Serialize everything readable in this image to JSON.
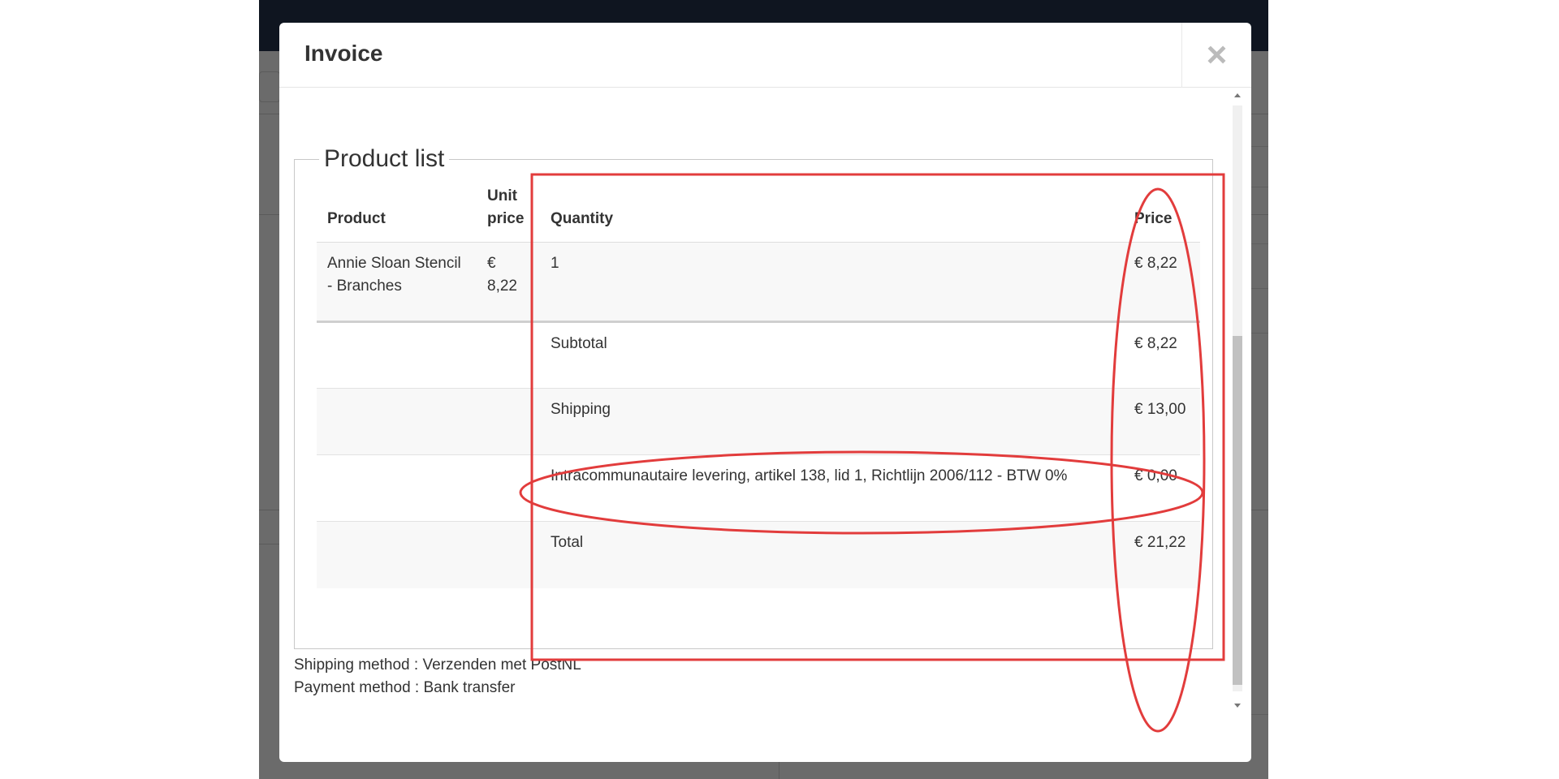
{
  "modal": {
    "title": "Invoice",
    "close_label": "×"
  },
  "fieldset": {
    "legend": "Product list"
  },
  "table": {
    "headers": {
      "product": "Product",
      "unit_price": "Unit price",
      "quantity": "Quantity",
      "price": "Price"
    },
    "items": [
      {
        "product": "Annie Sloan Stencil - Branches",
        "unit_price": "€ 8,22",
        "quantity": "1",
        "price": "€ 8,22"
      }
    ],
    "summary": [
      {
        "label": "Subtotal",
        "value": "€ 8,22"
      },
      {
        "label": "Shipping",
        "value": "€ 13,00"
      },
      {
        "label": "Intracommunautaire levering, artikel 138, lid 1, Richtlijn 2006/112 - BTW 0%",
        "value": "€ 0,00"
      },
      {
        "label": "Total",
        "value": "€ 21,22"
      }
    ]
  },
  "methods": {
    "shipping": "Shipping method : Verzenden met PostNL",
    "payment": "Payment method : Bank transfer"
  },
  "colors": {
    "annotation": "#e23c3c",
    "overlay_background": "#6b6b6b",
    "topbar": "#0f1520"
  }
}
